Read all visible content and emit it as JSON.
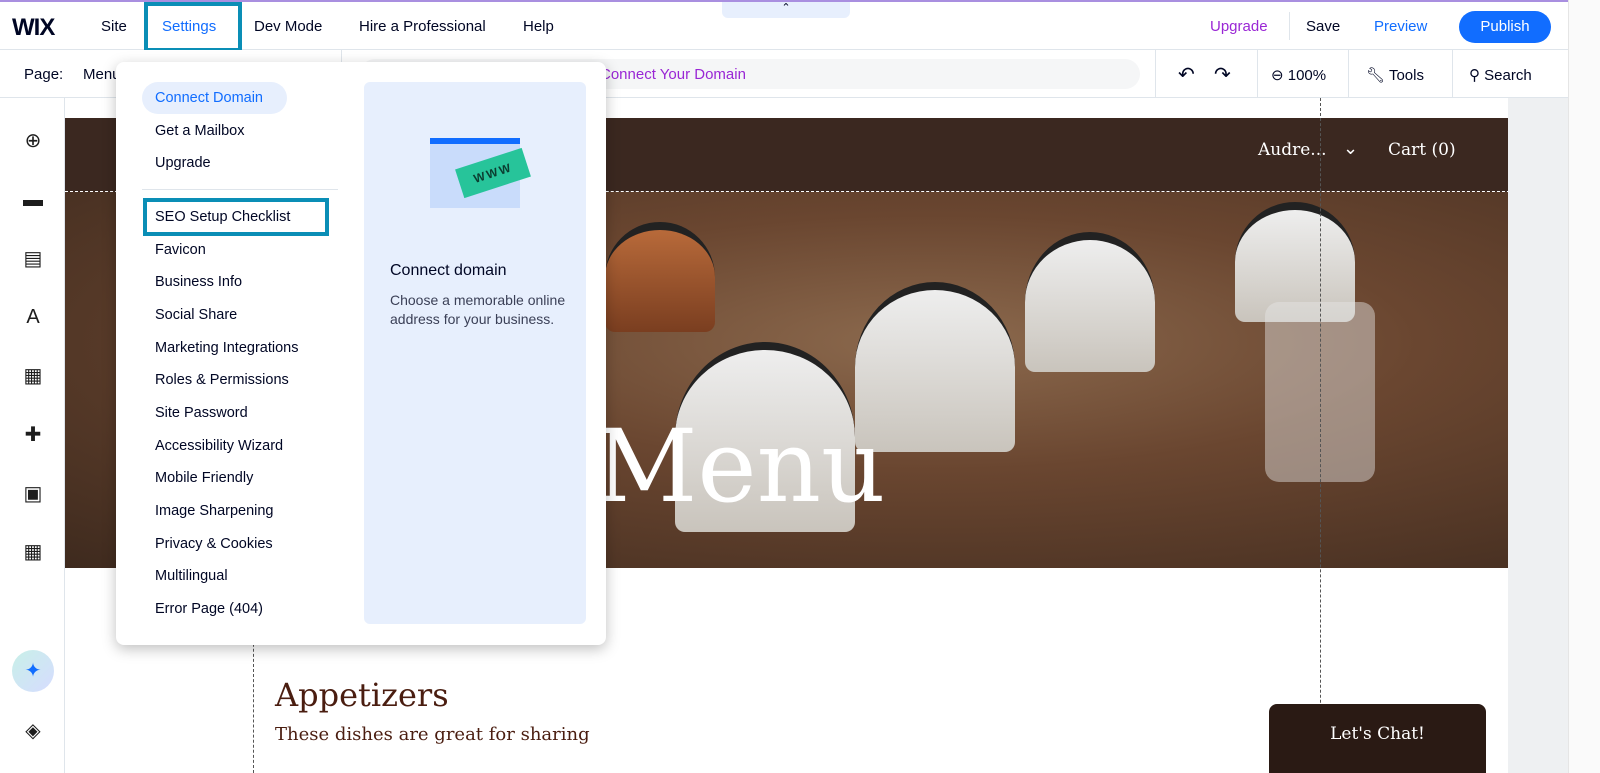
{
  "topbar": {
    "logo": "WIX",
    "nav": [
      "Site",
      "Settings",
      "Dev Mode",
      "Hire a Professional",
      "Help"
    ],
    "upgrade": "Upgrade",
    "save": "Save",
    "preview": "Preview",
    "publish": "Publish",
    "collapse_icon": "chevron-up-icon"
  },
  "toolbar": {
    "page_label": "Page:",
    "page_value": "Menu",
    "url_text": "Connect Your Domain",
    "zoom": "100%",
    "tools": "Tools",
    "search": "Search"
  },
  "sidebar": {
    "icons": [
      "add-icon",
      "sections-icon",
      "pages-icon",
      "design-icon",
      "apps-icon",
      "business-apps-icon",
      "media-icon",
      "cms-icon",
      "ai-assistant-icon",
      "layers-icon"
    ]
  },
  "settings_menu": {
    "items": [
      "Connect Domain",
      "Get a Mailbox",
      "Upgrade",
      "SEO Setup Checklist",
      "Favicon",
      "Business Info",
      "Social Share",
      "Marketing Integrations",
      "Roles & Permissions",
      "Site Password",
      "Accessibility Wizard",
      "Mobile Friendly",
      "Image Sharpening",
      "Privacy & Cookies",
      "Multilingual",
      "Error Page (404)"
    ],
    "promo": {
      "badge": "WWW",
      "title": "Connect domain",
      "description": "Choose a memorable online address for your business."
    }
  },
  "site": {
    "member": "Audre...",
    "cart": "Cart (0)",
    "hero_title": "Menu",
    "section_title": "Appetizers",
    "section_subtitle": "These dishes are great for sharing",
    "chat": "Let's Chat!"
  },
  "colors": {
    "accent": "#116dff",
    "highlight": "#0a8eb6",
    "upgrade": "#9a27d5"
  }
}
